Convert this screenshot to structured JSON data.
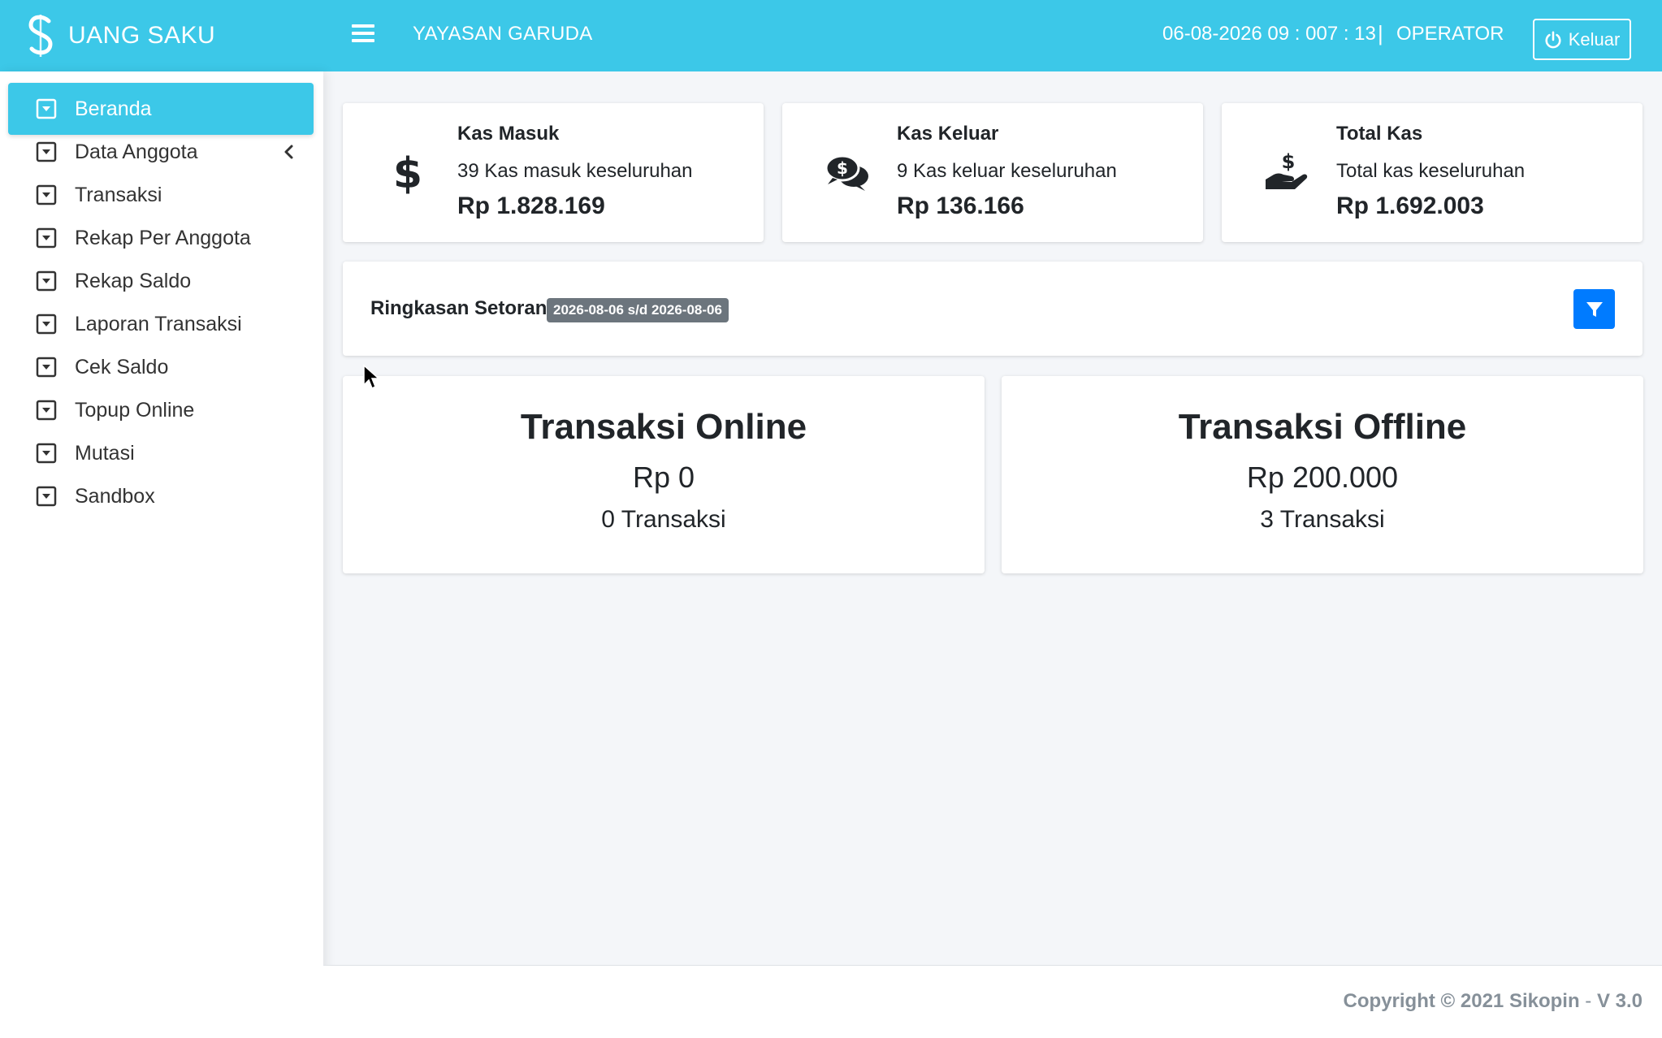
{
  "header": {
    "brand": "UANG SAKU",
    "org_name": "YAYASAN GARUDA",
    "datetime": "06-08-2026  09 : 007 : 13",
    "separator": "|",
    "role": "OPERATOR",
    "logout_label": "Keluar",
    "bg_color": "#3cc8e8"
  },
  "sidebar": {
    "items": [
      {
        "label": "Beranda",
        "active": true
      },
      {
        "label": "Data Anggota",
        "has_submenu": true
      },
      {
        "label": "Transaksi"
      },
      {
        "label": "Rekap Per Anggota"
      },
      {
        "label": "Rekap Saldo"
      },
      {
        "label": "Laporan Transaksi"
      },
      {
        "label": "Cek Saldo"
      },
      {
        "label": "Topup Online"
      },
      {
        "label": "Mutasi"
      },
      {
        "label": "Sandbox"
      }
    ]
  },
  "cards": [
    {
      "icon": "dollar-icon",
      "title": "Kas Masuk",
      "desc": "39 Kas masuk keseluruhan",
      "amount": "Rp 1.828.169"
    },
    {
      "icon": "comments-dollar-icon",
      "title": "Kas Keluar",
      "desc": "9 Kas keluar keseluruhan",
      "amount": "Rp 136.166"
    },
    {
      "icon": "hand-holding-dollar-icon",
      "title": "Total Kas",
      "desc": "Total kas keseluruhan",
      "amount": "Rp 1.692.003"
    }
  ],
  "summary": {
    "title": "Ringkasan Setoran",
    "badge": "2026-08-06 s/d 2026-08-06",
    "filter_icon": "filter-icon"
  },
  "transactions": [
    {
      "title": "Transaksi Online",
      "amount": "Rp 0",
      "count": "0 Transaksi"
    },
    {
      "title": "Transaksi Offline",
      "amount": "Rp 200.000",
      "count": "3 Transaksi"
    }
  ],
  "footer": {
    "copyright": "Copyright © 2021 Sikopin",
    "dash": " - ",
    "version": "V 3.0"
  }
}
